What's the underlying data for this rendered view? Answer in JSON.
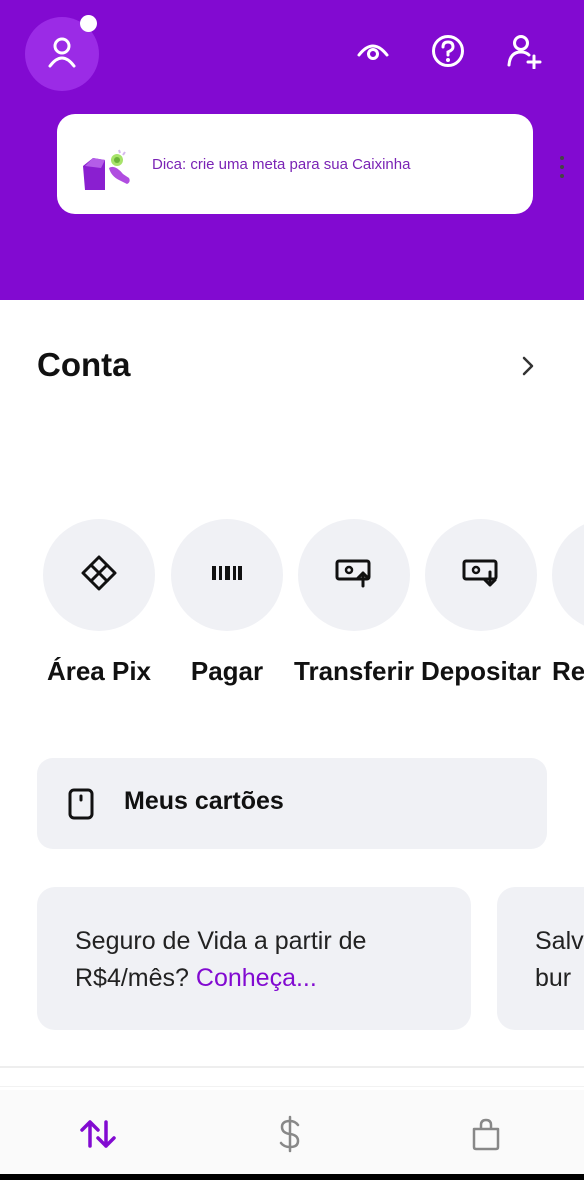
{
  "header": {
    "icons": [
      "profile-icon",
      "eye-icon",
      "help-icon",
      "add-person-icon"
    ],
    "tip": {
      "text": "Dica: crie uma meta para sua Caixinha"
    }
  },
  "account": {
    "title": "Conta"
  },
  "actions": [
    {
      "label": "Área Pix",
      "icon": "pix-icon"
    },
    {
      "label": "Pagar",
      "icon": "barcode-icon"
    },
    {
      "label": "Transferir",
      "icon": "transfer-icon"
    },
    {
      "label": "Depositar",
      "icon": "deposit-icon"
    },
    {
      "label": "Re",
      "icon": "partial-icon"
    }
  ],
  "cards": {
    "label": "Meus cartões"
  },
  "promos": [
    {
      "text": "Seguro de Vida a partir de R$4/mês?",
      "link": "Conheça..."
    },
    {
      "text": "Salv bur",
      "link": ""
    }
  ],
  "bottom_nav": [
    "transactions-icon",
    "dollar-icon",
    "shopping-bag-icon"
  ],
  "colors": {
    "brand": "#820ad1",
    "surface": "#f0f1f5"
  }
}
